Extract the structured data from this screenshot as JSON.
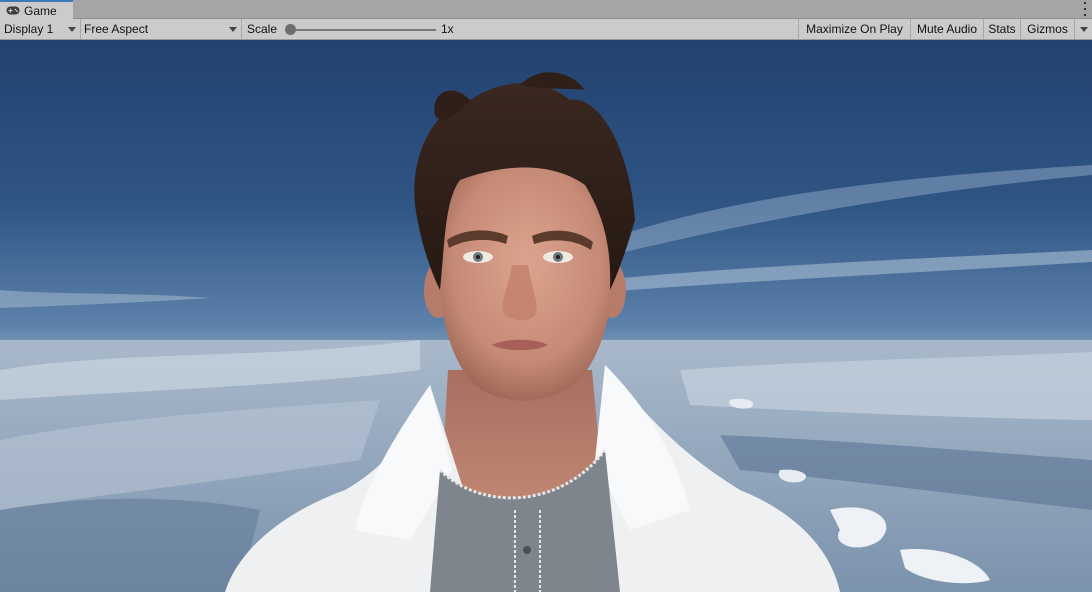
{
  "tab": {
    "label": "Game",
    "icon": "gamepad-icon"
  },
  "toolbar": {
    "display": "Display 1",
    "aspect": "Free Aspect",
    "scale_label": "Scale",
    "scale_value": "1x",
    "scale_slider_level": 0.0,
    "maximize": "Maximize On Play",
    "mute": "Mute Audio",
    "stats": "Stats",
    "gizmos": "Gizmos"
  },
  "colors": {
    "tab_accent": "#3a79bb",
    "toolbar_bg": "#cbcbcb",
    "sky": "#2c4d80"
  }
}
